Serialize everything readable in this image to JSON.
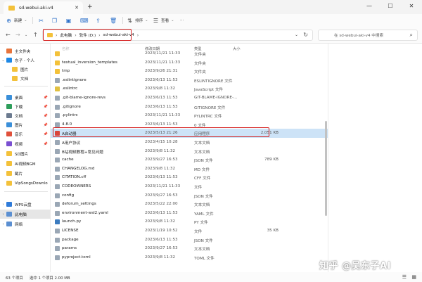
{
  "window": {
    "tab_title": "sd-webui-aki-v4",
    "new_tab": "+",
    "controls": [
      "—",
      "☐",
      "✕"
    ]
  },
  "toolbar": {
    "new_label": "新建",
    "sort_label": "排序",
    "view_label": "查看",
    "more_label": "···"
  },
  "address": {
    "breadcrumb": [
      "此电脑",
      "软件 (D:)",
      "sd-webui-aki-v4"
    ],
    "search_placeholder": "在 sd-webui-aki-v4 中搜索"
  },
  "sidebar": {
    "items": [
      {
        "label": "主文件夹",
        "color": "#e8743b",
        "expand": "",
        "pin": false
      },
      {
        "label": "东子 - 个人",
        "color": "#1e88e5",
        "expand": "⌄",
        "pin": false
      },
      {
        "label": "图片",
        "color": "#f3c13a",
        "expand": "",
        "pin": false
      },
      {
        "label": "文档",
        "color": "#f3c13a",
        "expand": "",
        "pin": false
      },
      {
        "label": "桌面",
        "color": "#3a8fd9",
        "expand": "",
        "pin": true
      },
      {
        "label": "下载",
        "color": "#2e9e5b",
        "expand": "",
        "pin": true
      },
      {
        "label": "文档",
        "color": "#6b7a8f",
        "expand": "",
        "pin": true
      },
      {
        "label": "图片",
        "color": "#3a8fd9",
        "expand": "",
        "pin": true
      },
      {
        "label": "音乐",
        "color": "#e0503a",
        "expand": "",
        "pin": true
      },
      {
        "label": "视频",
        "color": "#7a4fd1",
        "expand": "",
        "pin": true
      },
      {
        "label": "SD图片",
        "color": "#f3c13a",
        "expand": "",
        "pin": false
      },
      {
        "label": "AI视频BGM",
        "color": "#f3c13a",
        "expand": "",
        "pin": false
      },
      {
        "label": "截片",
        "color": "#f3c13a",
        "expand": "",
        "pin": false
      },
      {
        "label": "VipSongsDownlo",
        "color": "#f3c13a",
        "expand": "",
        "pin": false
      },
      {
        "label": "WPS云盘",
        "color": "#2f7bd9",
        "expand": "›",
        "pin": false
      },
      {
        "label": "此电脑",
        "color": "#5b8fd1",
        "expand": "›",
        "pin": false
      },
      {
        "label": "网络",
        "color": "#5b8fd1",
        "expand": "›",
        "pin": false
      }
    ]
  },
  "list": {
    "headers": {
      "name": "名称",
      "date": "修改日期",
      "type": "类型",
      "size": "大小"
    },
    "rows": [
      {
        "name": "",
        "date": "2023/11/21 11:33",
        "type": "文件夹",
        "size": "",
        "color": "#f3c13a",
        "selected": false
      },
      {
        "name": "textual_inversion_templates",
        "date": "2023/11/21 11:33",
        "type": "文件夹",
        "size": "",
        "color": "#f3c13a",
        "selected": false
      },
      {
        "name": "tmp",
        "date": "2023/9/26 21:31",
        "type": "文件夹",
        "size": "",
        "color": "#f3c13a",
        "selected": false
      },
      {
        "name": ".eslintignore",
        "date": "2023/6/13 11:53",
        "type": "ESLINTIGNORE 文件",
        "size": "",
        "color": "#9aa7b5",
        "selected": false
      },
      {
        "name": ".eslintrc",
        "date": "2023/9/8 11:32",
        "type": "JavaScript 文件",
        "size": "",
        "color": "#e0c040",
        "selected": false
      },
      {
        "name": ".git-blame-ignore-revs",
        "date": "2023/6/13 11:53",
        "type": "GIT-BLAME-IGNORE-...",
        "size": "",
        "color": "#9aa7b5",
        "selected": false
      },
      {
        "name": ".gitignore",
        "date": "2023/6/13 11:53",
        "type": "GITIGNORE 文件",
        "size": "",
        "color": "#9aa7b5",
        "selected": false
      },
      {
        "name": ".pylintrc",
        "date": "2023/11/21 11:33",
        "type": "PYLINTRC 文件",
        "size": "",
        "color": "#9aa7b5",
        "selected": false
      },
      {
        "name": "4.8.0",
        "date": "2023/6/13 11:53",
        "type": "0 文件",
        "size": "",
        "color": "#9aa7b5",
        "selected": false
      },
      {
        "name": "A启动器",
        "date": "2023/5/13 21:26",
        "type": "应用程序",
        "size": "2,051 KB",
        "color": "#d9463b",
        "selected": true
      },
      {
        "name": "A用户协议",
        "date": "2023/4/15 10:28",
        "type": "文本文档",
        "size": "",
        "color": "#9aa7b5",
        "selected": false
      },
      {
        "name": "B站视频教程+常见问题",
        "date": "2023/9/8 11:32",
        "type": "文本文档",
        "size": "",
        "color": "#9aa7b5",
        "selected": false
      },
      {
        "name": "cache",
        "date": "2023/9/27 16:53",
        "type": "JSON 文件",
        "size": "789 KB",
        "color": "#9aa7b5",
        "selected": false
      },
      {
        "name": "CHANGELOG.md",
        "date": "2023/9/8 11:32",
        "type": "MD 文件",
        "size": "",
        "color": "#9aa7b5",
        "selected": false
      },
      {
        "name": "CITATION.cff",
        "date": "2023/6/13 11:53",
        "type": "CFF 文件",
        "size": "",
        "color": "#9aa7b5",
        "selected": false
      },
      {
        "name": "CODEOWNERS",
        "date": "2023/11/21 11:33",
        "type": "文件",
        "size": "",
        "color": "#9aa7b5",
        "selected": false
      },
      {
        "name": "config",
        "date": "2023/9/27 16:53",
        "type": "JSON 文件",
        "size": "",
        "color": "#9aa7b5",
        "selected": false
      },
      {
        "name": "deforum_settings",
        "date": "2023/5/22 22:00",
        "type": "文本文档",
        "size": "",
        "color": "#9aa7b5",
        "selected": false
      },
      {
        "name": "environment-wsl2.yaml",
        "date": "2023/6/13 11:53",
        "type": "YAML 文件",
        "size": "",
        "color": "#9aa7b5",
        "selected": false
      },
      {
        "name": "launch.py",
        "date": "2023/9/8 11:32",
        "type": "PY 文件",
        "size": "",
        "color": "#3b7bbf",
        "selected": false
      },
      {
        "name": "LICENSE",
        "date": "2023/1/19 10:52",
        "type": "文件",
        "size": "35 KB",
        "color": "#9aa7b5",
        "selected": false
      },
      {
        "name": "package",
        "date": "2023/6/13 11:53",
        "type": "JSON 文件",
        "size": "",
        "color": "#9aa7b5",
        "selected": false
      },
      {
        "name": "params",
        "date": "2023/9/27 16:53",
        "type": "文本文档",
        "size": "",
        "color": "#9aa7b5",
        "selected": false
      },
      {
        "name": "pyproject.toml",
        "date": "2023/9/8 11:32",
        "type": "TOML 文件",
        "size": "",
        "color": "#9aa7b5",
        "selected": false
      }
    ]
  },
  "status": {
    "count": "63 个项目",
    "selected": "选中 1 个项目  2.00 MB"
  },
  "watermark": "知乎 @吴东子AI"
}
